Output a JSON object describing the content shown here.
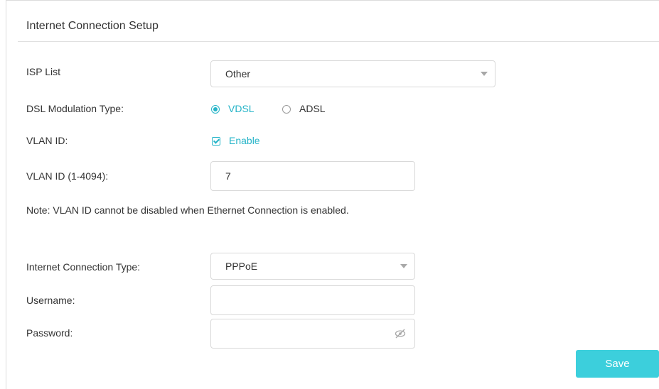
{
  "section": {
    "title": "Internet Connection Setup"
  },
  "isp_list": {
    "label": "ISP List",
    "value": "Other"
  },
  "dsl": {
    "label": "DSL Modulation Type:",
    "options": [
      {
        "label": "VDSL",
        "selected": true
      },
      {
        "label": "ADSL",
        "selected": false
      }
    ]
  },
  "vlan": {
    "label": "VLAN ID:",
    "enable_label": "Enable",
    "enabled": true
  },
  "vlan_id": {
    "label": "VLAN ID (1-4094):",
    "value": "7"
  },
  "note": "Note: VLAN ID cannot be disabled when Ethernet Connection is enabled.",
  "connection_type": {
    "label": "Internet Connection Type:",
    "value": "PPPoE"
  },
  "username": {
    "label": "Username:",
    "value": ""
  },
  "password": {
    "label": "Password:",
    "value": ""
  },
  "actions": {
    "save_label": "Save"
  },
  "colors": {
    "accent": "#25b4c8",
    "save_button": "#3ccfdc"
  },
  "icons": {
    "password_toggle": "eye-slash-icon"
  }
}
